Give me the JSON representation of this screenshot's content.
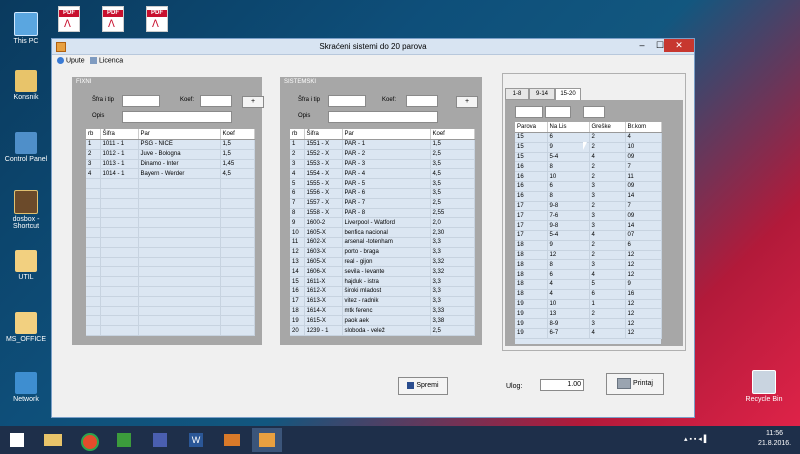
{
  "desktop": {
    "icons": [
      {
        "label": "This PC"
      },
      {
        "label": "Konsnik"
      },
      {
        "label": "Control Panel"
      },
      {
        "label": "dosbox - Shortcut"
      },
      {
        "label": "UTIL"
      },
      {
        "label": "MS_OFFICE"
      },
      {
        "label": "Network"
      },
      {
        "label": "Recycle Bin"
      }
    ],
    "pdf_label": "PDF"
  },
  "window": {
    "title": "Skraćeni sistemi do 20 parova",
    "controls": {
      "minimize": "–",
      "maximize": "☐",
      "close": "✕"
    },
    "menu": [
      {
        "label": "Upute"
      },
      {
        "label": "Licenca"
      }
    ]
  },
  "fixni": {
    "caption": "FIXNI",
    "sifra_label": "Šfra i tip",
    "koef_label": "Koef:",
    "opis_label": "Opis",
    "add_label": "+",
    "columns": [
      "rb",
      "Šifra",
      "Par",
      "Koef"
    ],
    "rows": [
      [
        "1",
        "1011 - 1",
        "PSG - NICE",
        "1,5"
      ],
      [
        "2",
        "1012 - 1",
        "Juve - Bologna",
        "1,5"
      ],
      [
        "3",
        "1013 - 1",
        "Dinamo - Inter",
        "1,45"
      ],
      [
        "4",
        "1014 - 1",
        "Bayern - Werder",
        "4,5"
      ]
    ]
  },
  "sistemski": {
    "caption": "SISTEMSKI",
    "sifra_label": "Šfra i tip",
    "koef_label": "Koef:",
    "opis_label": "Opis",
    "add_label": "+",
    "columns": [
      "rb",
      "Šifra",
      "Par",
      "Koef"
    ],
    "rows": [
      [
        "1",
        "1551 - X",
        "PAR - 1",
        "1,5"
      ],
      [
        "2",
        "1552 - X",
        "PAR - 2",
        "2,5"
      ],
      [
        "3",
        "1553 - X",
        "PAR - 3",
        "3,5"
      ],
      [
        "4",
        "1554 - X",
        "PAR - 4",
        "4,5"
      ],
      [
        "5",
        "1555 - X",
        "PAR - 5",
        "3,5"
      ],
      [
        "6",
        "1556 - X",
        "PAR - 6",
        "3,5"
      ],
      [
        "7",
        "1557 - X",
        "PAR - 7",
        "2,5"
      ],
      [
        "8",
        "1558 - X",
        "PAR - 8",
        "2,55"
      ],
      [
        "9",
        "1600-2",
        "Liverpool - Watford",
        "2,0"
      ],
      [
        "10",
        "1605-X",
        "benfica nacional",
        "2,30"
      ],
      [
        "11",
        "1602-X",
        "arsenal -totenham",
        "3,3"
      ],
      [
        "12",
        "1603-X",
        "porto - braga",
        "3,3"
      ],
      [
        "13",
        "1605-X",
        "real - gijon",
        "3,32"
      ],
      [
        "14",
        "1606-X",
        "sevila - levante",
        "3,32"
      ],
      [
        "15",
        "1611-X",
        "hajduk - istra",
        "3,3"
      ],
      [
        "16",
        "1612-X",
        "široki mladost",
        "3,3"
      ],
      [
        "17",
        "1613-X",
        "vitez - radnik",
        "3,3"
      ],
      [
        "18",
        "1614-X",
        "mtk ferenc",
        "3,33"
      ],
      [
        "19",
        "1615-X",
        "paok aek",
        "3,38"
      ],
      [
        "20",
        "1239 - 1",
        "sloboda - velež",
        "2,5"
      ]
    ]
  },
  "systems": {
    "tabs": [
      "1-8",
      "9-14",
      "15-20"
    ],
    "selected_tab": 2,
    "columns": [
      "Parova",
      "Na Lis",
      "Greške",
      "Br.kom"
    ],
    "rows": [
      [
        "15",
        "6",
        "2",
        "4"
      ],
      [
        "15",
        "9",
        "2",
        "10"
      ],
      [
        "15",
        "5-4",
        "4",
        "09"
      ],
      [
        "16",
        "8",
        "2",
        "7"
      ],
      [
        "16",
        "10",
        "2",
        "11"
      ],
      [
        "16",
        "6",
        "3",
        "09"
      ],
      [
        "16",
        "8",
        "3",
        "14"
      ],
      [
        "17",
        "9-8",
        "2",
        "7"
      ],
      [
        "17",
        "7-6",
        "3",
        "09"
      ],
      [
        "17",
        "9-8",
        "3",
        "14"
      ],
      [
        "17",
        "5-4",
        "4",
        "07"
      ],
      [
        "18",
        "9",
        "2",
        "6"
      ],
      [
        "18",
        "12",
        "2",
        "12"
      ],
      [
        "18",
        "8",
        "3",
        "12"
      ],
      [
        "18",
        "6",
        "4",
        "12"
      ],
      [
        "18",
        "4",
        "5",
        "9"
      ],
      [
        "18",
        "4",
        "6",
        "16"
      ],
      [
        "19",
        "10",
        "1",
        "12"
      ],
      [
        "19",
        "13",
        "2",
        "12"
      ],
      [
        "19",
        "8-9",
        "3",
        "12"
      ],
      [
        "19",
        "6-7",
        "4",
        "12"
      ]
    ]
  },
  "footer": {
    "spremi_label": "Spremi",
    "ulog_label": "Ulog:",
    "ulog_value": "1.00",
    "print_label": "Printaj"
  },
  "taskbar": {
    "time": "11:56",
    "date": "21.8.2016."
  }
}
